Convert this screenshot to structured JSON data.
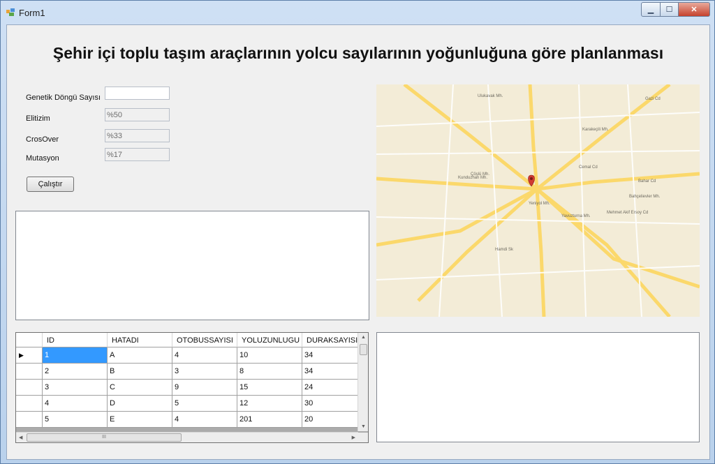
{
  "window": {
    "title": "Form1"
  },
  "heading": "Şehir içi toplu taşım araçlarının yolcu sayılarının yoğunluğuna göre planlanması",
  "form": {
    "genetik_label": "Genetik Döngü Sayısı",
    "genetik_value": "",
    "elitizm_label": "Elitizim",
    "elitizm_value": "%50",
    "crossover_label": "CrosOver",
    "crossover_value": "%33",
    "mutasyon_label": "Mutasyon",
    "mutasyon_value": "%17",
    "run_button": "Çalıştır"
  },
  "map": {
    "labels": [
      "Ulukavak Mh.",
      "Karakeçili Mh.",
      "Kunduzhan Mh.",
      "Çöşlü Mh.",
      "Yeniyol Mh.",
      "Bahçelievler Mh.",
      "Yavuzturna Mh.",
      "Gazi Cd",
      "Bahar Cd",
      "Cemal Cd",
      "Hamdi Sk",
      "Mehmet Akif Ersoy Cd"
    ],
    "pin_color": "#d03a32"
  },
  "grid": {
    "columns": [
      "ID",
      "HATADI",
      "OTOBUSSAYISI",
      "YOLUZUNLUGU",
      "DURAKSAYISI"
    ],
    "rows": [
      [
        "1",
        "A",
        "4",
        "10",
        "34"
      ],
      [
        "2",
        "B",
        "3",
        "8",
        "34"
      ],
      [
        "3",
        "C",
        "9",
        "15",
        "24"
      ],
      [
        "4",
        "D",
        "5",
        "12",
        "30"
      ],
      [
        "5",
        "E",
        "4",
        "201",
        "20"
      ]
    ],
    "current_row_marker": "▶",
    "hscroll_thumb": "III"
  }
}
